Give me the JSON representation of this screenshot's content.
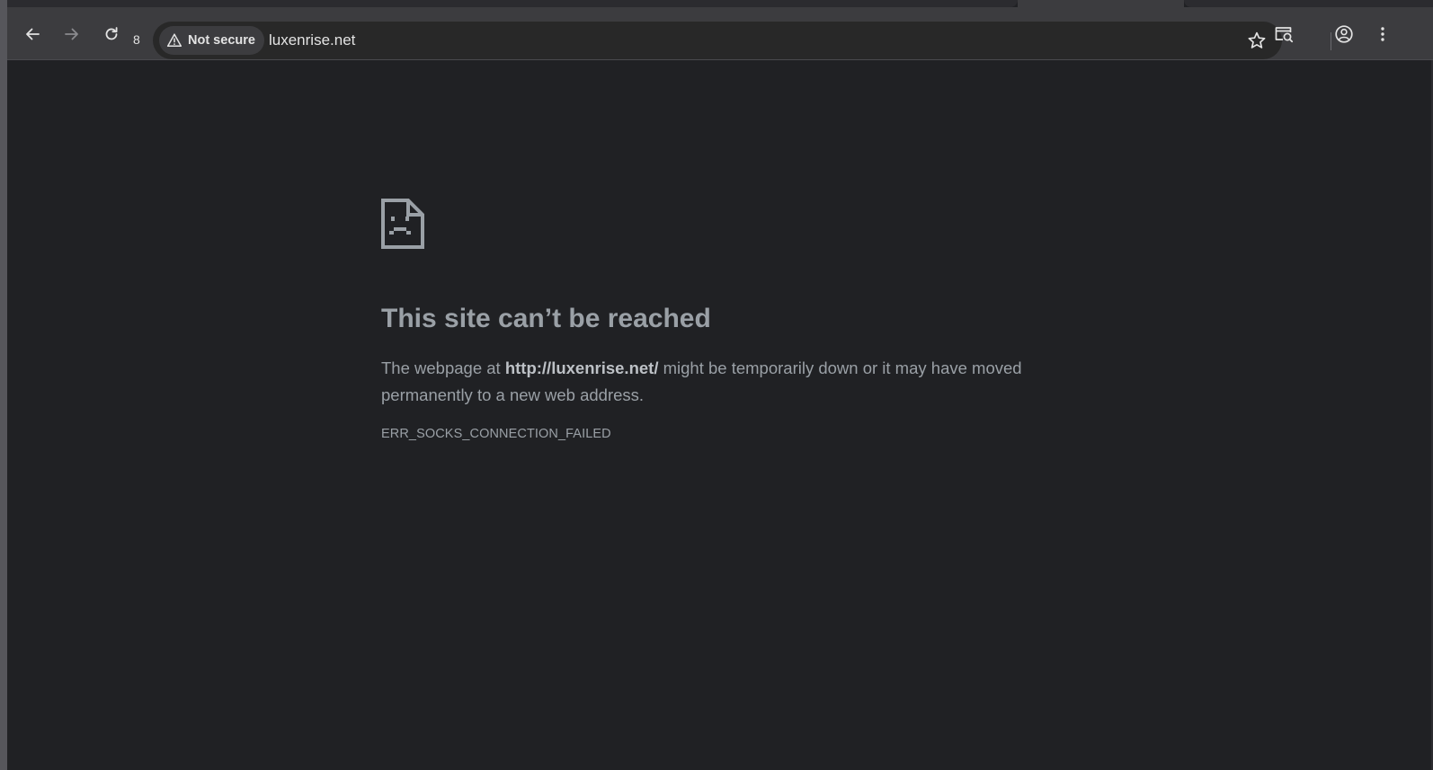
{
  "browser": {
    "reload_count": "8",
    "security_label": "Not secure",
    "url": "luxenrise.net",
    "icons": [
      "back-arrow-icon",
      "forward-arrow-icon",
      "reload-icon",
      "warning-triangle-icon",
      "star-icon",
      "tab-search-icon",
      "profile-icon",
      "more-vertical-icon"
    ]
  },
  "error": {
    "title": "This site can’t be reached",
    "desc_prefix": "The webpage at ",
    "desc_url": "http://luxenrise.net/",
    "desc_suffix": " might be temporarily down or it may have moved permanently to a new web address.",
    "code": "ERR_SOCKS_CONNECTION_FAILED"
  },
  "colors": {
    "page_bg": "#202124",
    "toolbar_bg": "#3c3c3f",
    "omnibox_bg": "#282828",
    "text_muted": "#9aa0a6",
    "text_light": "#e3e3e3"
  }
}
